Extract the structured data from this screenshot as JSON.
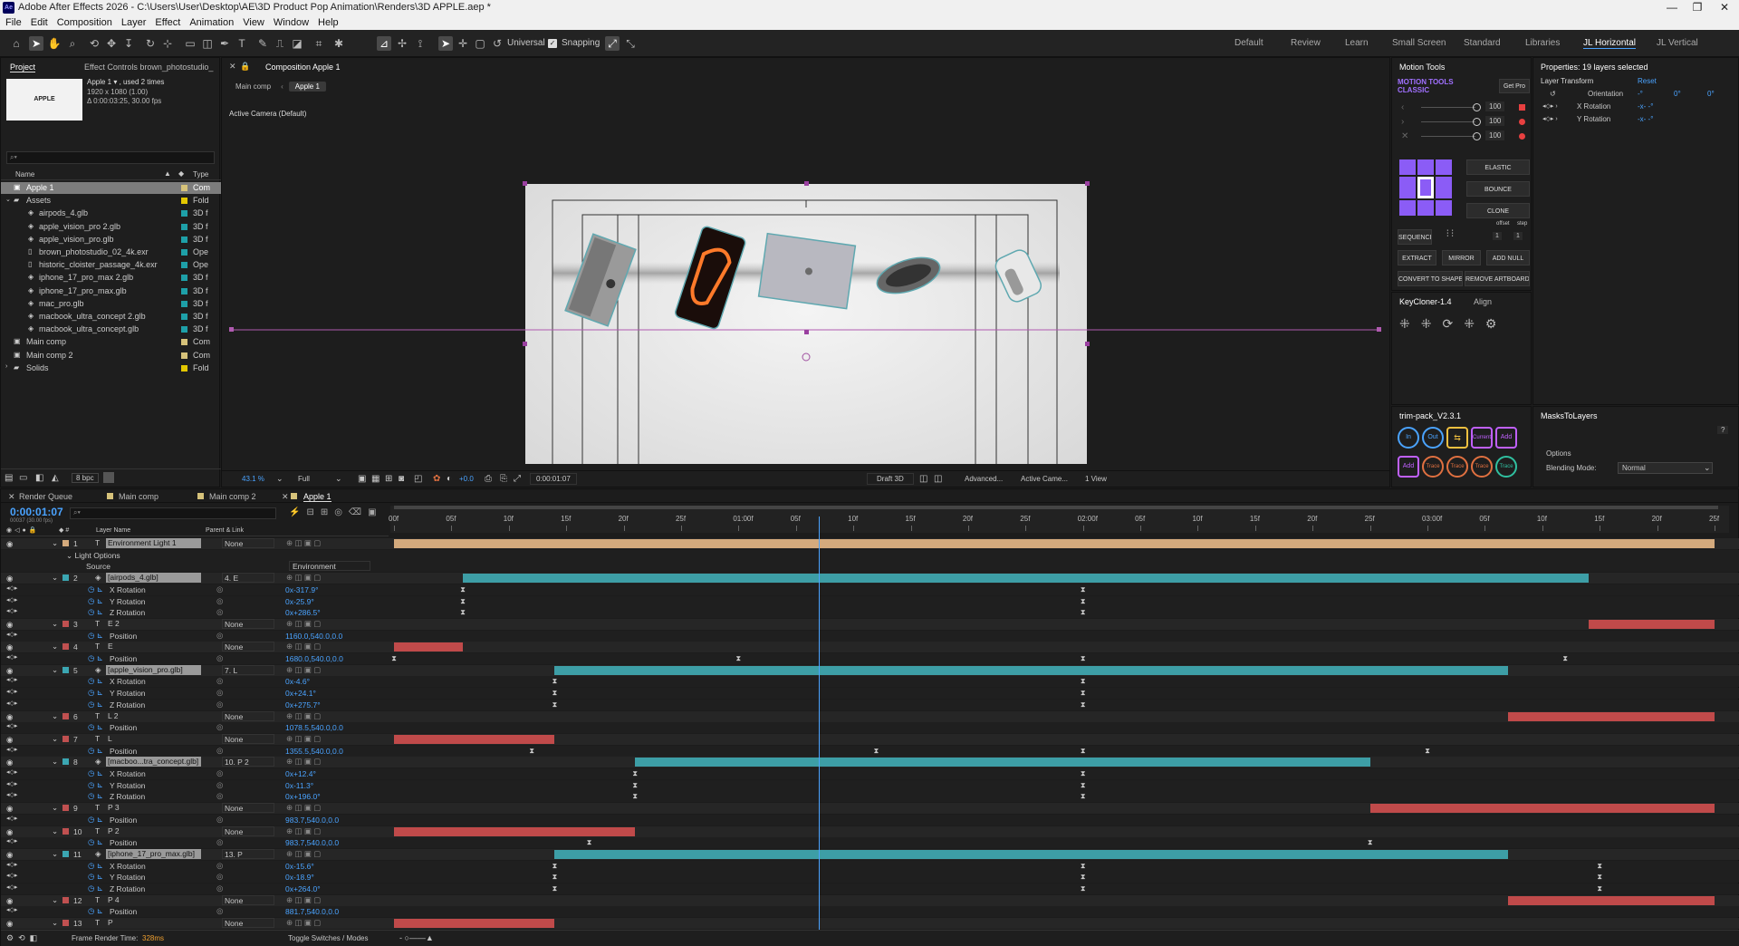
{
  "app": {
    "title": "Adobe After Effects 2026 - C:\\Users\\User\\Desktop\\AE\\3D Product Pop Animation\\Renders\\3D APPLE.aep *",
    "logo_text": "Ae",
    "window_controls": [
      "—",
      "❐",
      "✕"
    ]
  },
  "menu": [
    "File",
    "Edit",
    "Composition",
    "Layer",
    "Effect",
    "Animation",
    "View",
    "Window",
    "Help"
  ],
  "toolbar": {
    "universal_label": "Universal",
    "snapping_label": "Snapping",
    "workspaces": [
      "Default",
      "Review",
      "Learn",
      "Small Screen",
      "Standard",
      "Libraries",
      "JL Horizontal",
      "JL Vertical"
    ],
    "active_workspace": "JL Horizontal"
  },
  "project": {
    "tab_project": "Project",
    "tab_effect_controls": "Effect Controls brown_photostudio_",
    "thumb_text": "APPLE",
    "info_name": "Apple 1 ▾ , used 2 times",
    "info_size": "1920 x 1080 (1.00)",
    "info_duration": "Δ 0:00:03:25, 30.00 fps",
    "search_placeholder": "⌕▾",
    "col_name": "Name",
    "col_type": "Type",
    "items": [
      {
        "name": "Apple 1",
        "type": "Com",
        "color": "#d6c27a",
        "indent": 0,
        "selected": true,
        "kind": "comp"
      },
      {
        "name": "Assets",
        "type": "Fold",
        "color": "#e3c700",
        "indent": 0,
        "kind": "folder",
        "open": true
      },
      {
        "name": "airpods_4.glb",
        "type": "3D f",
        "color": "#1ea0a8",
        "indent": 1,
        "kind": "3d"
      },
      {
        "name": "apple_vision_pro 2.glb",
        "type": "3D f",
        "color": "#1ea0a8",
        "indent": 1,
        "kind": "3d"
      },
      {
        "name": "apple_vision_pro.glb",
        "type": "3D f",
        "color": "#1ea0a8",
        "indent": 1,
        "kind": "3d"
      },
      {
        "name": "brown_photostudio_02_4k.exr",
        "type": "Ope",
        "color": "#1ea0a8",
        "indent": 1,
        "kind": "file"
      },
      {
        "name": "historic_cloister_passage_4k.exr",
        "type": "Ope",
        "color": "#1ea0a8",
        "indent": 1,
        "kind": "file"
      },
      {
        "name": "iphone_17_pro_max 2.glb",
        "type": "3D f",
        "color": "#1ea0a8",
        "indent": 1,
        "kind": "3d"
      },
      {
        "name": "iphone_17_pro_max.glb",
        "type": "3D f",
        "color": "#1ea0a8",
        "indent": 1,
        "kind": "3d"
      },
      {
        "name": "mac_pro.glb",
        "type": "3D f",
        "color": "#1ea0a8",
        "indent": 1,
        "kind": "3d"
      },
      {
        "name": "macbook_ultra_concept 2.glb",
        "type": "3D f",
        "color": "#1ea0a8",
        "indent": 1,
        "kind": "3d"
      },
      {
        "name": "macbook_ultra_concept.glb",
        "type": "3D f",
        "color": "#1ea0a8",
        "indent": 1,
        "kind": "3d"
      },
      {
        "name": "Main comp",
        "type": "Com",
        "color": "#d6c27a",
        "indent": 0,
        "kind": "comp"
      },
      {
        "name": "Main comp 2",
        "type": "Com",
        "color": "#d6c27a",
        "indent": 0,
        "kind": "comp"
      },
      {
        "name": "Solids",
        "type": "Fold",
        "color": "#e3c700",
        "indent": 0,
        "kind": "folder"
      }
    ],
    "bpc": "8 bpc"
  },
  "comp": {
    "tab": "Composition Apple 1",
    "breadcrumbs": [
      "Main comp",
      "Apple 1"
    ],
    "camera_label": "Active Camera (Default)",
    "zoom": "43.1 %",
    "resolution": "Full",
    "exposure": "+0.0",
    "timecode": "0:00:01:07",
    "renderer": "Draft 3D",
    "advanced": "Advanced...",
    "camera": "Active Came...",
    "views": "1 View"
  },
  "motion_tools": {
    "tab": "Motion Tools",
    "brand_line1": "MOTION TOOLS",
    "brand_line2": "CLASSIC",
    "get_pro": "Get Pro",
    "slider_values": [
      "100",
      "100",
      "100"
    ],
    "buttons": [
      "ELASTIC",
      "BOUNCE",
      "CLONE",
      "SEQUENCE",
      "EXTRACT",
      "MIRROR",
      "ADD NULL",
      "CONVERT TO SHAPE",
      "REMOVE ARTBOARD"
    ],
    "offset_label": "offset",
    "step_label": "step",
    "offset_value": "1",
    "step_value": "1"
  },
  "keycloner": {
    "tab": "KeyCloner-1.4",
    "tab2": "Align"
  },
  "trimpack": {
    "tab": "trim-pack_V2.3.1",
    "buttons": [
      "In",
      "Out",
      "⇆",
      "Current",
      "Add",
      "Add",
      "Trace",
      "Trace",
      "Trace",
      "Trace"
    ]
  },
  "properties": {
    "tab": "Properties: 19 layers selected",
    "section": "Layer Transform",
    "reset": "Reset",
    "rows": [
      {
        "label": "Orientation",
        "v1": "-°",
        "v2": "0°",
        "v3": "0°"
      },
      {
        "label": "X Rotation",
        "v1": "-x- -°"
      },
      {
        "label": "Y Rotation",
        "v1": "-x- -°"
      }
    ]
  },
  "masks": {
    "tab": "MasksToLayers",
    "options": "Options",
    "blend_label": "Blending Mode:",
    "blend_value": "Normal"
  },
  "timeline": {
    "tabs": [
      "Render Queue",
      "Main comp",
      "Main comp 2",
      "Apple 1"
    ],
    "active_tab": "Apple 1",
    "current_time": "0:00:01:07",
    "fps_line": "00037 (30.00 fps)",
    "col_layer_name": "Layer Name",
    "col_parent": "Parent & Link",
    "ruler": [
      "00f",
      "05f",
      "10f",
      "15f",
      "20f",
      "25f",
      "01:00f",
      "05f",
      "10f",
      "15f",
      "20f",
      "25f",
      "02:00f",
      "05f",
      "10f",
      "15f",
      "20f",
      "25f",
      "03:00f",
      "05f",
      "10f",
      "15f",
      "20f",
      "25f"
    ],
    "playhead_frame": 37,
    "total_frames": 115,
    "rows": [
      {
        "kind": "layer",
        "num": "1",
        "name": "Environment Light 1",
        "parent": "None",
        "color": "#d4aa7d",
        "bar": [
          0,
          115
        ],
        "barcolor": "#d4aa7d",
        "selected": true
      },
      {
        "kind": "prop",
        "label": "Light Options",
        "indent": 1
      },
      {
        "kind": "prop",
        "label": "Source",
        "indent": 2,
        "value": "Environment",
        "value2": "brown_photostudio"
      },
      {
        "kind": "layer",
        "num": "2",
        "name": "[airpods_4.glb]",
        "parent": "4. E",
        "color": "#3ba6b2",
        "bar": [
          6,
          104
        ],
        "barcolor": "#3d9ea6",
        "selected": true
      },
      {
        "kind": "prop",
        "label": "X Rotation",
        "value": "0x-317.9°",
        "keys": [
          6,
          60
        ]
      },
      {
        "kind": "prop",
        "label": "Y Rotation",
        "value": "0x-25.9°",
        "keys": [
          6,
          60
        ]
      },
      {
        "kind": "prop",
        "label": "Z Rotation",
        "value": "0x+286.5°",
        "keys": [
          6,
          60
        ]
      },
      {
        "kind": "layer",
        "num": "3",
        "name": "E 2",
        "parent": "None",
        "color": "#c05050",
        "bar": [
          104,
          115
        ],
        "barcolor": "#c04a4a"
      },
      {
        "kind": "prop",
        "label": "Position",
        "value": "1160.0,540.0,0.0",
        "keys": []
      },
      {
        "kind": "layer",
        "num": "4",
        "name": "E",
        "parent": "None",
        "color": "#c05050",
        "bar": [
          0,
          6
        ],
        "barcolor": "#c04a4a"
      },
      {
        "kind": "prop",
        "label": "Position",
        "value": "1680.0,540.0,0.0",
        "keys": [
          0,
          30,
          60,
          102
        ]
      },
      {
        "kind": "layer",
        "num": "5",
        "name": "[apple_vision_pro.glb]",
        "parent": "7. L",
        "color": "#3ba6b2",
        "bar": [
          14,
          97
        ],
        "barcolor": "#3d9ea6",
        "selected": true
      },
      {
        "kind": "prop",
        "label": "X Rotation",
        "value": "0x-4.6°",
        "keys": [
          14,
          60
        ]
      },
      {
        "kind": "prop",
        "label": "Y Rotation",
        "value": "0x+24.1°",
        "keys": [
          14,
          60
        ]
      },
      {
        "kind": "prop",
        "label": "Z Rotation",
        "value": "0x+275.7°",
        "keys": [
          14,
          60
        ]
      },
      {
        "kind": "layer",
        "num": "6",
        "name": "L 2",
        "parent": "None",
        "color": "#c05050",
        "bar": [
          97,
          115
        ],
        "barcolor": "#c04a4a"
      },
      {
        "kind": "prop",
        "label": "Position",
        "value": "1078.5,540.0,0.0",
        "keys": []
      },
      {
        "kind": "layer",
        "num": "7",
        "name": "L",
        "parent": "None",
        "color": "#c05050",
        "bar": [
          0,
          14
        ],
        "barcolor": "#c04a4a"
      },
      {
        "kind": "prop",
        "label": "Position",
        "value": "1355.5,540.0,0.0",
        "keys": [
          12,
          42,
          60,
          90
        ]
      },
      {
        "kind": "layer",
        "num": "8",
        "name": "[macboo...tra_concept.glb]",
        "parent": "10. P 2",
        "color": "#3ba6b2",
        "bar": [
          21,
          85
        ],
        "barcolor": "#3d9ea6",
        "selected": true
      },
      {
        "kind": "prop",
        "label": "X Rotation",
        "value": "0x+12.4°",
        "keys": [
          21,
          60
        ]
      },
      {
        "kind": "prop",
        "label": "Y Rotation",
        "value": "0x-11.3°",
        "keys": [
          21,
          60
        ]
      },
      {
        "kind": "prop",
        "label": "Z Rotation",
        "value": "0x+196.0°",
        "keys": [
          21,
          60
        ]
      },
      {
        "kind": "layer",
        "num": "9",
        "name": "P 3",
        "parent": "None",
        "color": "#c05050",
        "bar": [
          85,
          115
        ],
        "barcolor": "#c04a4a"
      },
      {
        "kind": "prop",
        "label": "Position",
        "value": "983.7,540.0,0.0",
        "keys": []
      },
      {
        "kind": "layer",
        "num": "10",
        "name": "P 2",
        "parent": "None",
        "color": "#c05050",
        "bar": [
          0,
          21
        ],
        "barcolor": "#c04a4a"
      },
      {
        "kind": "prop",
        "label": "Position",
        "value": "983.7,540.0,0.0",
        "keys": [
          17,
          85
        ]
      },
      {
        "kind": "layer",
        "num": "11",
        "name": "[iphone_17_pro_max.glb]",
        "parent": "13. P",
        "color": "#3ba6b2",
        "bar": [
          14,
          97
        ],
        "barcolor": "#3d9ea6",
        "selected": true
      },
      {
        "kind": "prop",
        "label": "X Rotation",
        "value": "0x-15.6°",
        "keys": [
          14,
          60,
          105
        ]
      },
      {
        "kind": "prop",
        "label": "Y Rotation",
        "value": "0x-18.9°",
        "keys": [
          14,
          60,
          105
        ]
      },
      {
        "kind": "prop",
        "label": "Z Rotation",
        "value": "0x+264.0°",
        "keys": [
          14,
          60,
          105
        ]
      },
      {
        "kind": "layer",
        "num": "12",
        "name": "P 4",
        "parent": "None",
        "color": "#c05050",
        "bar": [
          97,
          115
        ],
        "barcolor": "#c04a4a"
      },
      {
        "kind": "prop",
        "label": "Position",
        "value": "881.7,540.0,0.0",
        "keys": []
      },
      {
        "kind": "layer",
        "num": "13",
        "name": "P",
        "parent": "None",
        "color": "#c05050",
        "bar": [
          0,
          14
        ],
        "barcolor": "#c04a4a"
      }
    ],
    "footer_render": "Frame Render Time: ",
    "footer_render_value": "328ms",
    "footer_toggle": "Toggle Switches / Modes"
  }
}
